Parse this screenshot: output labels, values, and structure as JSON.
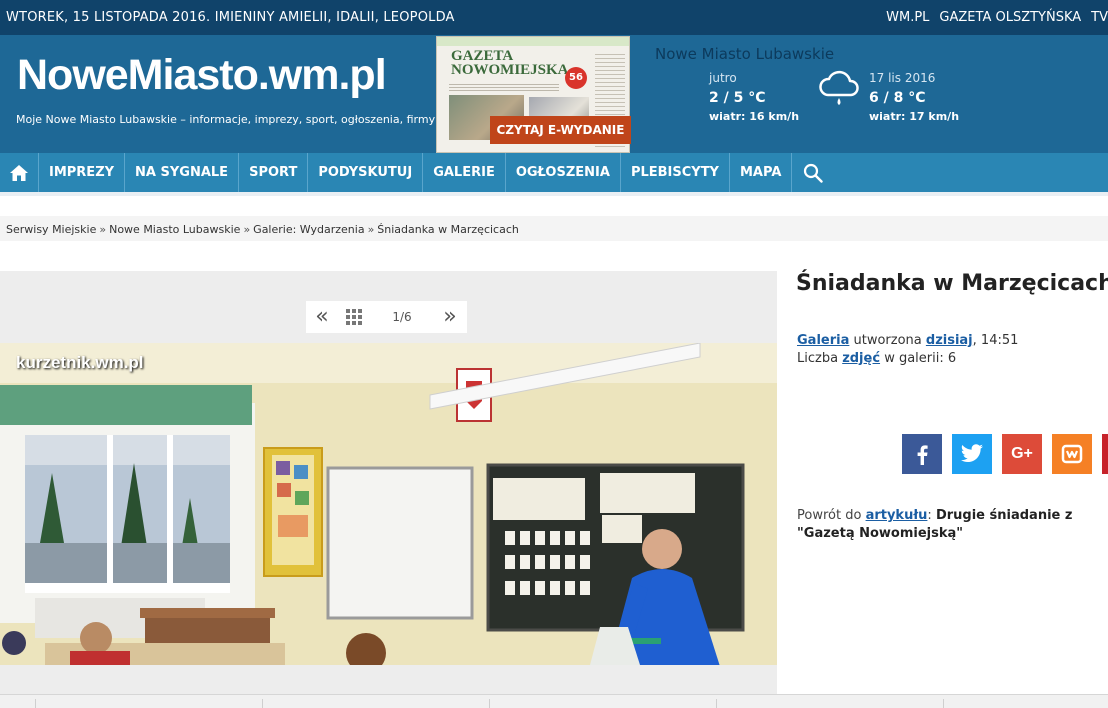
{
  "topbar": {
    "date_line": "WTOREK, 15 LISTOPADA 2016. IMIENINY AMIELII, IDALII, LEOPOLDA",
    "links": [
      "WM.PL",
      "GAZETA OLSZTYŃSKA",
      "TV"
    ]
  },
  "header": {
    "logo": "NoweMiasto.wm.pl",
    "tagline": "Moje Nowe Miasto Lubawskie – informacje, imprezy, sport, ogłoszenia, firmy",
    "paper_title_1": "GAZETA",
    "paper_title_2": "NOWOMIEJSKA",
    "paper_number": "56",
    "ebutton": "CZYTAJ E-WYDANIE"
  },
  "weather": {
    "city": "Nowe Miasto Lubawskie",
    "tomorrow": {
      "label": "jutro",
      "temp": "2 / 5 °C",
      "wind": "wiatr: 16 km/h"
    },
    "dayafter": {
      "label": "17 lis 2016",
      "temp": "6 / 8 °C",
      "wind": "wiatr: 17 km/h"
    },
    "icon": "rain-cloud-icon"
  },
  "nav": {
    "items": [
      "IMPREZY",
      "NA SYGNALE",
      "SPORT",
      "PODYSKUTUJ",
      "GALERIE",
      "OGŁOSZENIA",
      "PLEBISCYTY",
      "MAPA"
    ]
  },
  "breadcrumb": [
    "Serwisy Miejskie",
    "Nowe Miasto Lubawskie",
    "Galerie: Wydarzenia",
    "Śniadanka w Marzęcicach"
  ],
  "gallery": {
    "counter": "1/6",
    "prev": "«",
    "next": "»",
    "watermark": "kurzetnik.wm.pl"
  },
  "article": {
    "title": "Śniadanka w Marzęcicach",
    "gallery_link": "Galeria",
    "created_text": "utworzona",
    "created_link": "dzisiaj",
    "created_time": ", 14:51",
    "count_prefix": "Liczba",
    "count_link": "zdjęć",
    "count_suffix": "w galerii: 6",
    "back_prefix": "Powrót do",
    "back_link": "artykułu",
    "back_colon": ":",
    "back_title": "Drugie śniadanie z \"Gazetą Nowomiejską\""
  },
  "share": {
    "colors": [
      "#3b5998",
      "#1da1f2",
      "#dd4b39",
      "#f58025",
      "#c7232b"
    ]
  }
}
